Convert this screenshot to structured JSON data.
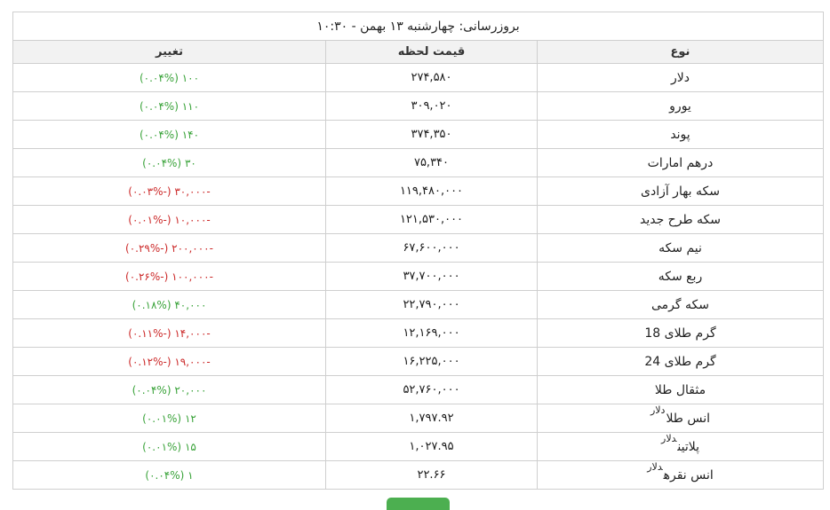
{
  "update": {
    "title": "بروزرسانی: چهارشنبه ۱۳ بهمن - ۱۰:۳۰"
  },
  "columns": {
    "type": "نوع",
    "price": "قیمت لحظه",
    "change": "تغییر"
  },
  "colors": {
    "positive": "#3aa33a",
    "negative": "#cc2a2a",
    "header_bg": "#f2f2f2",
    "border": "#cfcfcf",
    "button": "#4caf50"
  },
  "rows": [
    {
      "name": "دلار",
      "unit": "",
      "price": "۲۷۴,۵۸۰",
      "change": "۱۰۰",
      "percent": "(۰.۰۴%)",
      "direction": "up"
    },
    {
      "name": "یورو",
      "unit": "",
      "price": "۳۰۹,۰۲۰",
      "change": "۱۱۰",
      "percent": "(۰.۰۴%)",
      "direction": "up"
    },
    {
      "name": "پوند",
      "unit": "",
      "price": "۳۷۴,۳۵۰",
      "change": "۱۴۰",
      "percent": "(۰.۰۴%)",
      "direction": "up"
    },
    {
      "name": "درهم امارات",
      "unit": "",
      "price": "۷۵,۳۴۰",
      "change": "۳۰",
      "percent": "(۰.۰۴%)",
      "direction": "up"
    },
    {
      "name": "سکه بهار آزادی",
      "unit": "",
      "price": "۱۱۹,۴۸۰,۰۰۰",
      "change": "-۳۰,۰۰۰",
      "percent": "(-۰.۰۳%)",
      "direction": "down"
    },
    {
      "name": "سکه طرح جدید",
      "unit": "",
      "price": "۱۲۱,۵۳۰,۰۰۰",
      "change": "-۱۰,۰۰۰",
      "percent": "(-۰.۰۱%)",
      "direction": "down"
    },
    {
      "name": "نیم سکه",
      "unit": "",
      "price": "۶۷,۶۰۰,۰۰۰",
      "change": "-۲۰۰,۰۰۰",
      "percent": "(-۰.۲۹%)",
      "direction": "down"
    },
    {
      "name": "ربع سکه",
      "unit": "",
      "price": "۳۷,۷۰۰,۰۰۰",
      "change": "-۱۰۰,۰۰۰",
      "percent": "(-۰.۲۶%)",
      "direction": "down"
    },
    {
      "name": "سکه گرمی",
      "unit": "",
      "price": "۲۲,۷۹۰,۰۰۰",
      "change": "۴۰,۰۰۰",
      "percent": "(۰.۱۸%)",
      "direction": "up"
    },
    {
      "name": "گرم طلای 18",
      "unit": "",
      "price": "۱۲,۱۶۹,۰۰۰",
      "change": "-۱۴,۰۰۰",
      "percent": "(-۰.۱۱%)",
      "direction": "down"
    },
    {
      "name": "گرم طلای 24",
      "unit": "",
      "price": "۱۶,۲۲۵,۰۰۰",
      "change": "-۱۹,۰۰۰",
      "percent": "(-۰.۱۲%)",
      "direction": "down"
    },
    {
      "name": "مثقال طلا",
      "unit": "",
      "price": "۵۲,۷۶۰,۰۰۰",
      "change": "۲۰,۰۰۰",
      "percent": "(۰.۰۴%)",
      "direction": "up"
    },
    {
      "name": "انس طلا",
      "unit": "دلار",
      "price": "۱,۷۹۷.۹۲",
      "change": "۱۲",
      "percent": "(۰.۰۱%)",
      "direction": "up"
    },
    {
      "name": "پلاتین",
      "unit": "دلار",
      "price": "۱,۰۲۷.۹۵",
      "change": "۱۵",
      "percent": "(۰.۰۱%)",
      "direction": "up"
    },
    {
      "name": "انس نقره",
      "unit": "دلار",
      "price": "۲۲.۶۶",
      "change": "۱",
      "percent": "(۰.۰۴%)",
      "direction": "up"
    }
  ]
}
